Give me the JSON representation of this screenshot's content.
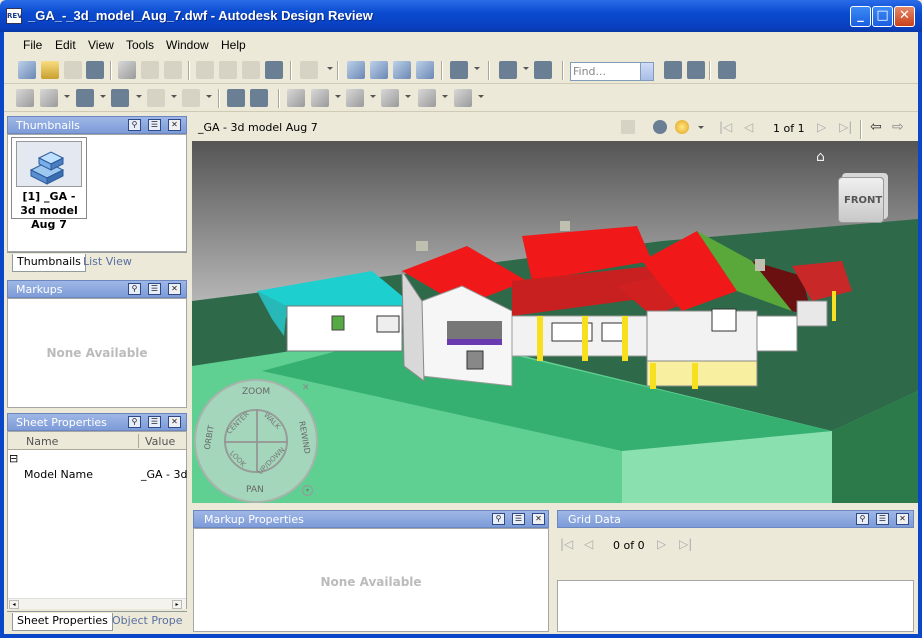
{
  "window": {
    "title": "_GA_-_3d_model_Aug_7.dwf - Autodesk Design Review",
    "app_icon_text": "REV",
    "minimize": "_",
    "maximize": "□",
    "close": "✕"
  },
  "menu": [
    "File",
    "Edit",
    "View",
    "Tools",
    "Window",
    "Help"
  ],
  "toolbar": {
    "find_placeholder": "Find..."
  },
  "thumbnails_panel": {
    "title": "Thumbnails",
    "items": [
      {
        "label": "[1] _GA - 3d model Aug 7"
      }
    ],
    "tabs": [
      "Thumbnails",
      "List View"
    ]
  },
  "markups_panel": {
    "title": "Markups",
    "empty_text": "None Available"
  },
  "sheet_properties_panel": {
    "title": "Sheet Properties",
    "columns": [
      "Name",
      "Value"
    ],
    "expand_glyph": "⊟",
    "rows": [
      {
        "name": "Model Name",
        "value": "_GA - 3d"
      }
    ],
    "tabs": [
      "Sheet Properties",
      "Object Prope"
    ]
  },
  "viewer": {
    "title": "_GA - 3d model Aug 7",
    "page_indicator": "1 of 1"
  },
  "nav_wheel": {
    "zoom": "ZOOM",
    "orbit": "ORBIT",
    "center": "CENTER",
    "walk": "WALK",
    "rewind": "REWIND",
    "look": "LOOK",
    "updown": "UP/DOWN",
    "pan": "PAN"
  },
  "viewcube": {
    "face": "FRONT"
  },
  "markup_properties_panel": {
    "title": "Markup Properties",
    "empty_text": "None Available"
  },
  "grid_data_panel": {
    "title": "Grid Data",
    "page_indicator": "0 of 0"
  },
  "colors": {
    "title_blue": "#0a4bd0",
    "panel_title": "#7d9bd8",
    "ground_green": "#2e6a4a",
    "roof_red": "#f01818",
    "roof_cyan": "#1ecfcf",
    "roof_green": "#5aa83a",
    "roof_maroon": "#6a1010"
  }
}
